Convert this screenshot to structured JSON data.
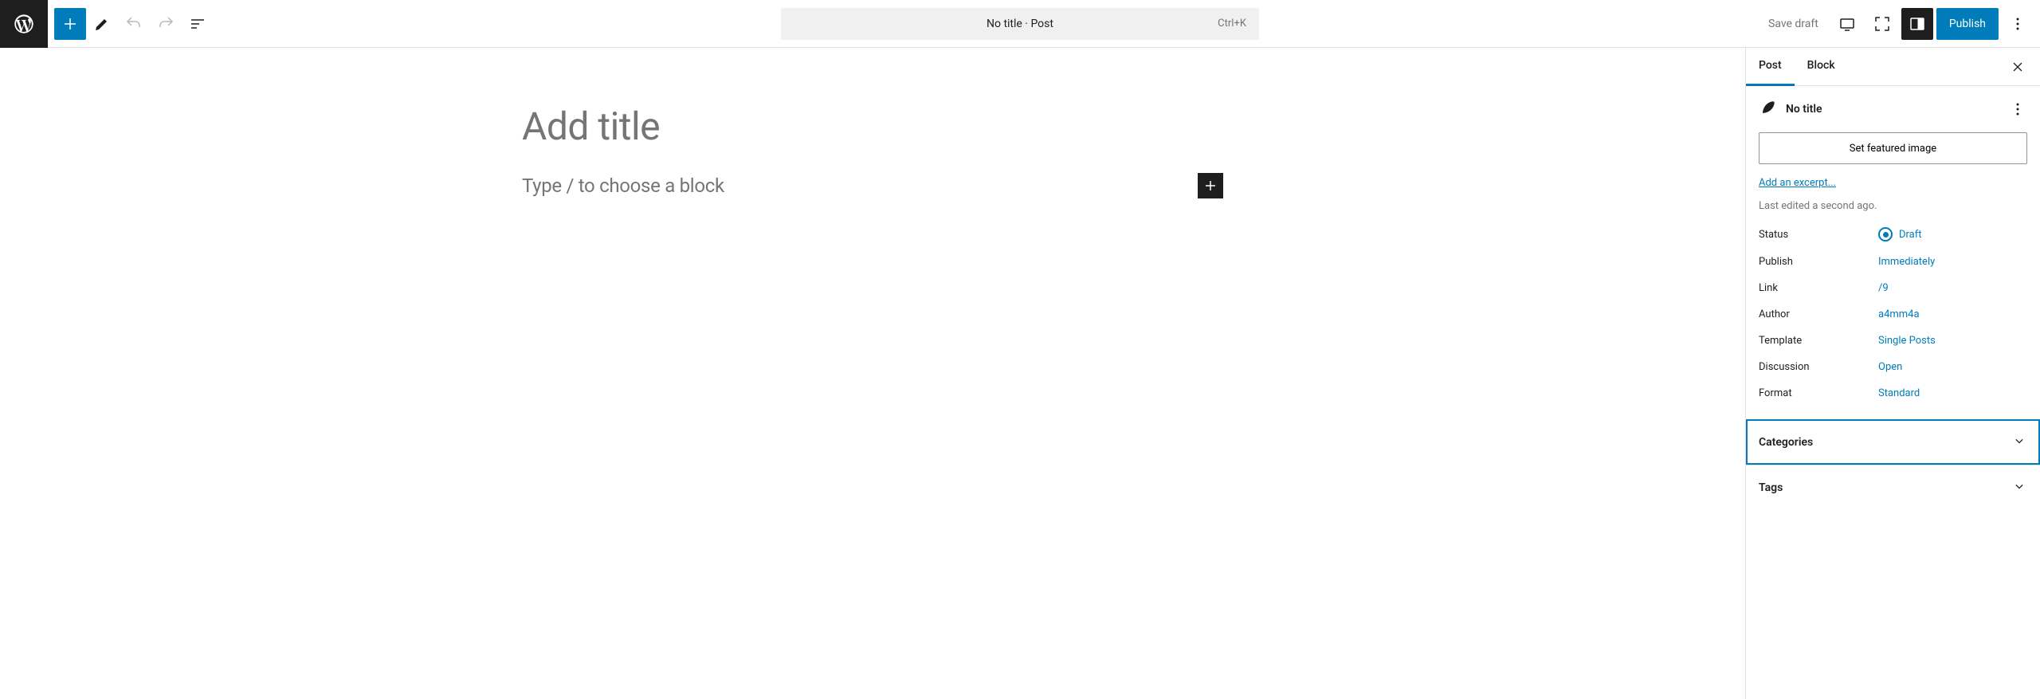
{
  "toolbar": {
    "doc_title": "No title · Post",
    "shortcut": "Ctrl+K",
    "save_draft": "Save draft",
    "publish": "Publish"
  },
  "editor": {
    "title_placeholder": "Add title",
    "block_prompt": "Type / to choose a block"
  },
  "sidebar": {
    "tabs": {
      "post": "Post",
      "block": "Block"
    },
    "panel_title": "No title",
    "featured_image_btn": "Set featured image",
    "excerpt_link": "Add an excerpt...",
    "last_edited": "Last edited a second ago.",
    "summary": {
      "status": {
        "label": "Status",
        "value": "Draft"
      },
      "publish": {
        "label": "Publish",
        "value": "Immediately"
      },
      "link": {
        "label": "Link",
        "value": "/9"
      },
      "author": {
        "label": "Author",
        "value": "a4mm4a"
      },
      "template": {
        "label": "Template",
        "value": "Single Posts"
      },
      "discussion": {
        "label": "Discussion",
        "value": "Open"
      },
      "format": {
        "label": "Format",
        "value": "Standard"
      }
    },
    "accordions": {
      "categories": "Categories",
      "tags": "Tags"
    }
  }
}
